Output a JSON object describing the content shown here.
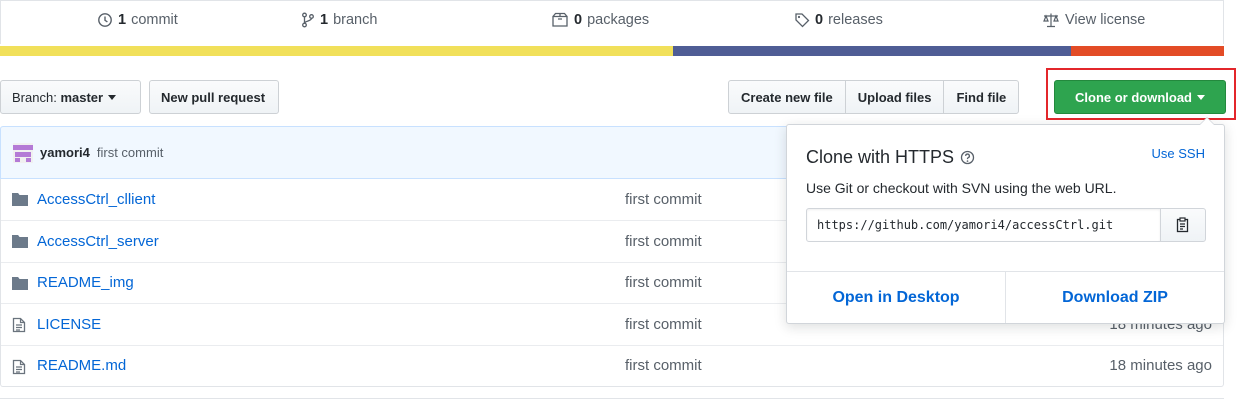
{
  "summary": {
    "commits": {
      "count": "1",
      "label": "commit",
      "icon": "history-icon"
    },
    "branches": {
      "count": "1",
      "label": "branch",
      "icon": "git-branch-icon"
    },
    "packages": {
      "count": "0",
      "label": "packages",
      "icon": "package-icon"
    },
    "releases": {
      "count": "0",
      "label": "releases",
      "icon": "tag-icon"
    },
    "license": {
      "label": "View license",
      "icon": "law-icon"
    }
  },
  "languages": [
    {
      "color": "#f1e05a",
      "share": 55
    },
    {
      "color": "#4f5d95",
      "share": 32.5
    },
    {
      "color": "#e34c26",
      "share": 12.5
    }
  ],
  "nav": {
    "branch_prefix": "Branch:",
    "branch_name": "master",
    "new_pr": "New pull request",
    "create_file": "Create new file",
    "upload_files": "Upload files",
    "find_file": "Find file",
    "clone_download": "Clone or download"
  },
  "commit_tease": {
    "author": "yamori4",
    "message": "first commit"
  },
  "files": [
    {
      "type": "dir",
      "name": "AccessCtrl_cllient",
      "message": "first commit",
      "age": ""
    },
    {
      "type": "dir",
      "name": "AccessCtrl_server",
      "message": "first commit",
      "age": ""
    },
    {
      "type": "dir",
      "name": "README_img",
      "message": "first commit",
      "age": ""
    },
    {
      "type": "file",
      "name": "LICENSE",
      "message": "first commit",
      "age": "18 minutes ago"
    },
    {
      "type": "file",
      "name": "README.md",
      "message": "first commit",
      "age": "18 minutes ago"
    }
  ],
  "clone_dropdown": {
    "title": "Clone with HTTPS",
    "use_ssh": "Use SSH",
    "description": "Use Git or checkout with SVN using the web URL.",
    "url": "https://github.com/yamori4/accessCtrl.git",
    "open_desktop": "Open in Desktop",
    "download_zip": "Download ZIP"
  },
  "colors": {
    "link": "#0366d6",
    "clone_button": "#2ea44f",
    "highlight_box": "#e3262b",
    "commit_tease_bg": "#f1f8ff"
  }
}
